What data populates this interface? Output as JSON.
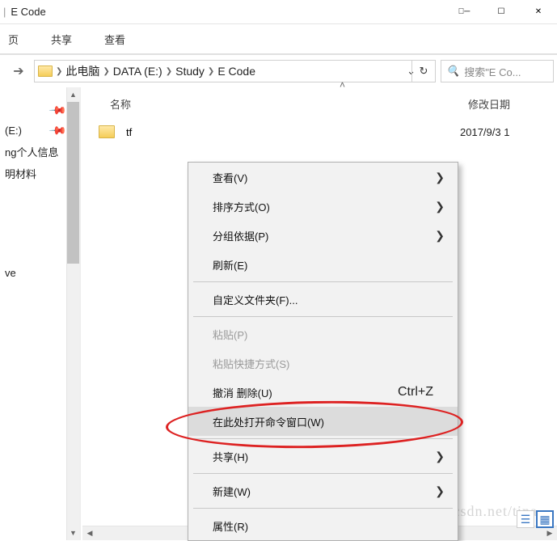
{
  "title": "E Code",
  "menu": {
    "m1": "页",
    "m2": "共享",
    "m3": "查看"
  },
  "breadcrumb": {
    "pc": "此电脑",
    "data": "DATA (E:)",
    "study": "Study",
    "ecode": "E Code"
  },
  "search": {
    "placeholder": "搜索\"E Co..."
  },
  "columns": {
    "name": "名称",
    "modified": "修改日期"
  },
  "sidebar": {
    "i1": "",
    "i2": " (E:)",
    "i3": "ng个人信息",
    "i4": "明材料",
    "i5": "",
    "i6": "ve"
  },
  "file": {
    "name": "tf",
    "date": "2017/9/3 1"
  },
  "ctx": {
    "view": "查看(V)",
    "sort": "排序方式(O)",
    "group": "分组依据(P)",
    "refresh": "刷新(E)",
    "custom": "自定义文件夹(F)...",
    "paste": "粘贴(P)",
    "pasteShort": "粘贴快捷方式(S)",
    "undo": "撤消 删除(U)",
    "undoKey": "Ctrl+Z",
    "opencmd": "在此处打开命令窗口(W)",
    "share": "共享(H)",
    "new": "新建(W)",
    "props": "属性(R)"
  },
  "watermark": "http://blog.csdn.net/tina"
}
